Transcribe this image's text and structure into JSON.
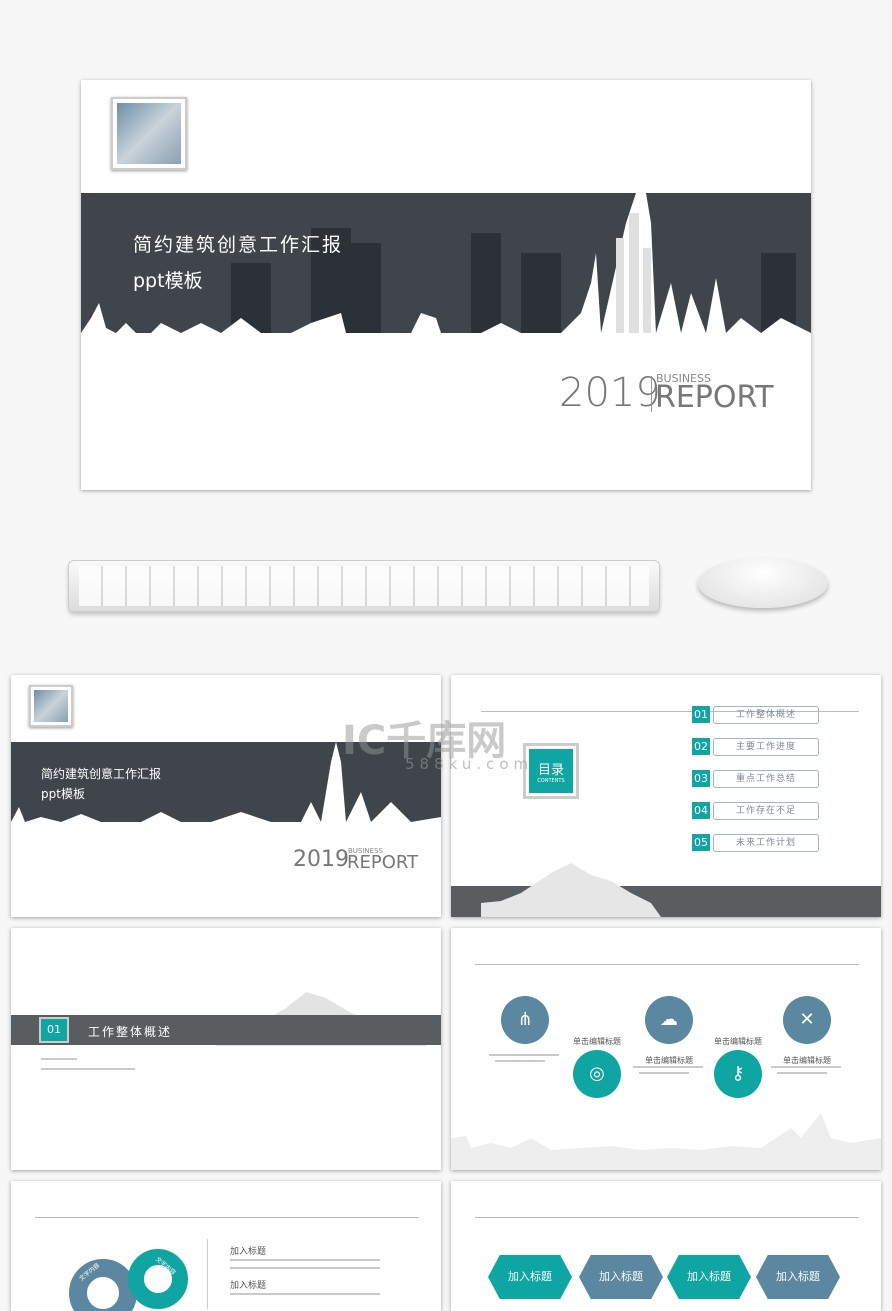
{
  "cover": {
    "title_line1": "简约建筑创意工作汇报",
    "title_line2": "ppt模板",
    "year": "2019",
    "business": "BUSINESS",
    "report": "REPORT"
  },
  "watermark": {
    "logo": "IC千库网",
    "url": "588ku.com"
  },
  "contents": {
    "title": "目录",
    "subtitle": "CONTENTS",
    "items": [
      {
        "num": "01",
        "label": "工作整体概述"
      },
      {
        "num": "02",
        "label": "主要工作进度"
      },
      {
        "num": "03",
        "label": "重点工作总结"
      },
      {
        "num": "04",
        "label": "工作存在不足"
      },
      {
        "num": "05",
        "label": "未来工作计划"
      }
    ]
  },
  "section": {
    "num": "01",
    "title": "工作整体概述"
  },
  "timeline": {
    "items": [
      {
        "icon": "hierarchy-icon",
        "title": "",
        "color": "#5b88a0"
      },
      {
        "icon": "lifebuoy-icon",
        "title": "单击编辑标题",
        "color": "#0fa5a3"
      },
      {
        "icon": "cloud-upload-icon",
        "title": "单击编辑标题",
        "color": "#5b88a0"
      },
      {
        "icon": "key-icon",
        "title": "单击编辑标题",
        "color": "#0fa5a3"
      },
      {
        "icon": "tools-icon",
        "title": "单击编辑标题",
        "color": "#5b88a0"
      }
    ]
  },
  "cycle": {
    "left_label": "文字内容",
    "right_label": "文字内容",
    "headings": [
      "加入标题",
      "加入标题"
    ]
  },
  "hexes": [
    {
      "label": "加入标题",
      "color": "#0fa5a3"
    },
    {
      "label": "加入标题",
      "color": "#5b88a0"
    },
    {
      "label": "加入标题",
      "color": "#0fa5a3"
    },
    {
      "label": "加入标题",
      "color": "#5b88a0"
    }
  ],
  "colors": {
    "teal": "#0fa5a3",
    "blue_gray": "#5b88a0",
    "dark_band": "#3f454b"
  }
}
